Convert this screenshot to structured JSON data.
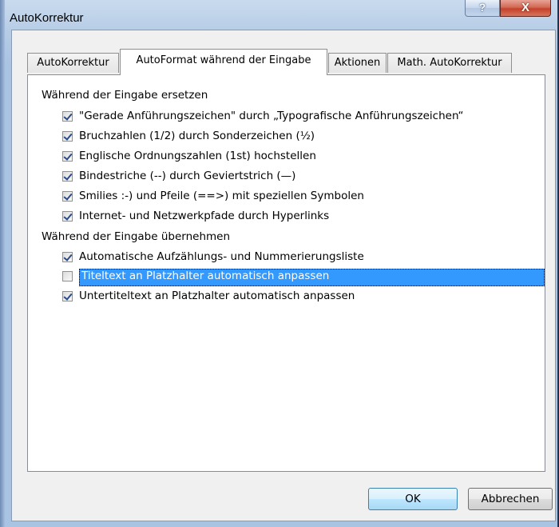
{
  "window": {
    "title": "AutoKorrektur",
    "help_glyph": "?",
    "close_glyph": "X"
  },
  "tabs": [
    {
      "label": "AutoKorrektur",
      "active": false
    },
    {
      "label": "AutoFormat während der Eingabe",
      "active": true
    },
    {
      "label": "Aktionen",
      "active": false
    },
    {
      "label": "Math. AutoKorrektur",
      "active": false
    }
  ],
  "groups": {
    "replace": {
      "label": "Während der Eingabe ersetzen",
      "items": [
        {
          "label": "\"Gerade Anführungszeichen\" durch „Typografische Anführungszeichen“",
          "checked": true
        },
        {
          "label": "Bruchzahlen (1/2) durch Sonderzeichen (½)",
          "checked": true
        },
        {
          "label": "Englische Ordnungszahlen (1st) hochstellen",
          "checked": true
        },
        {
          "label": "Bindestriche (--) durch Geviertstrich (—)",
          "checked": true
        },
        {
          "label": "Smilies :-) und Pfeile (==>) mit speziellen Symbolen",
          "checked": true
        },
        {
          "label": "Internet- und Netzwerkpfade durch Hyperlinks",
          "checked": true
        }
      ]
    },
    "apply": {
      "label": "Während der Eingabe übernehmen",
      "items": [
        {
          "label": "Automatische Aufzählungs- und Nummerierungsliste",
          "checked": true
        },
        {
          "label": "Titeltext an Platzhalter automatisch anpassen",
          "checked": false,
          "selected": true
        },
        {
          "label": "Untertiteltext an Platzhalter automatisch anpassen",
          "checked": true
        }
      ]
    }
  },
  "buttons": {
    "ok": "OK",
    "cancel": "Abbrechen"
  },
  "colors": {
    "selection": "#3399ff",
    "close_button": "#c4422a"
  }
}
